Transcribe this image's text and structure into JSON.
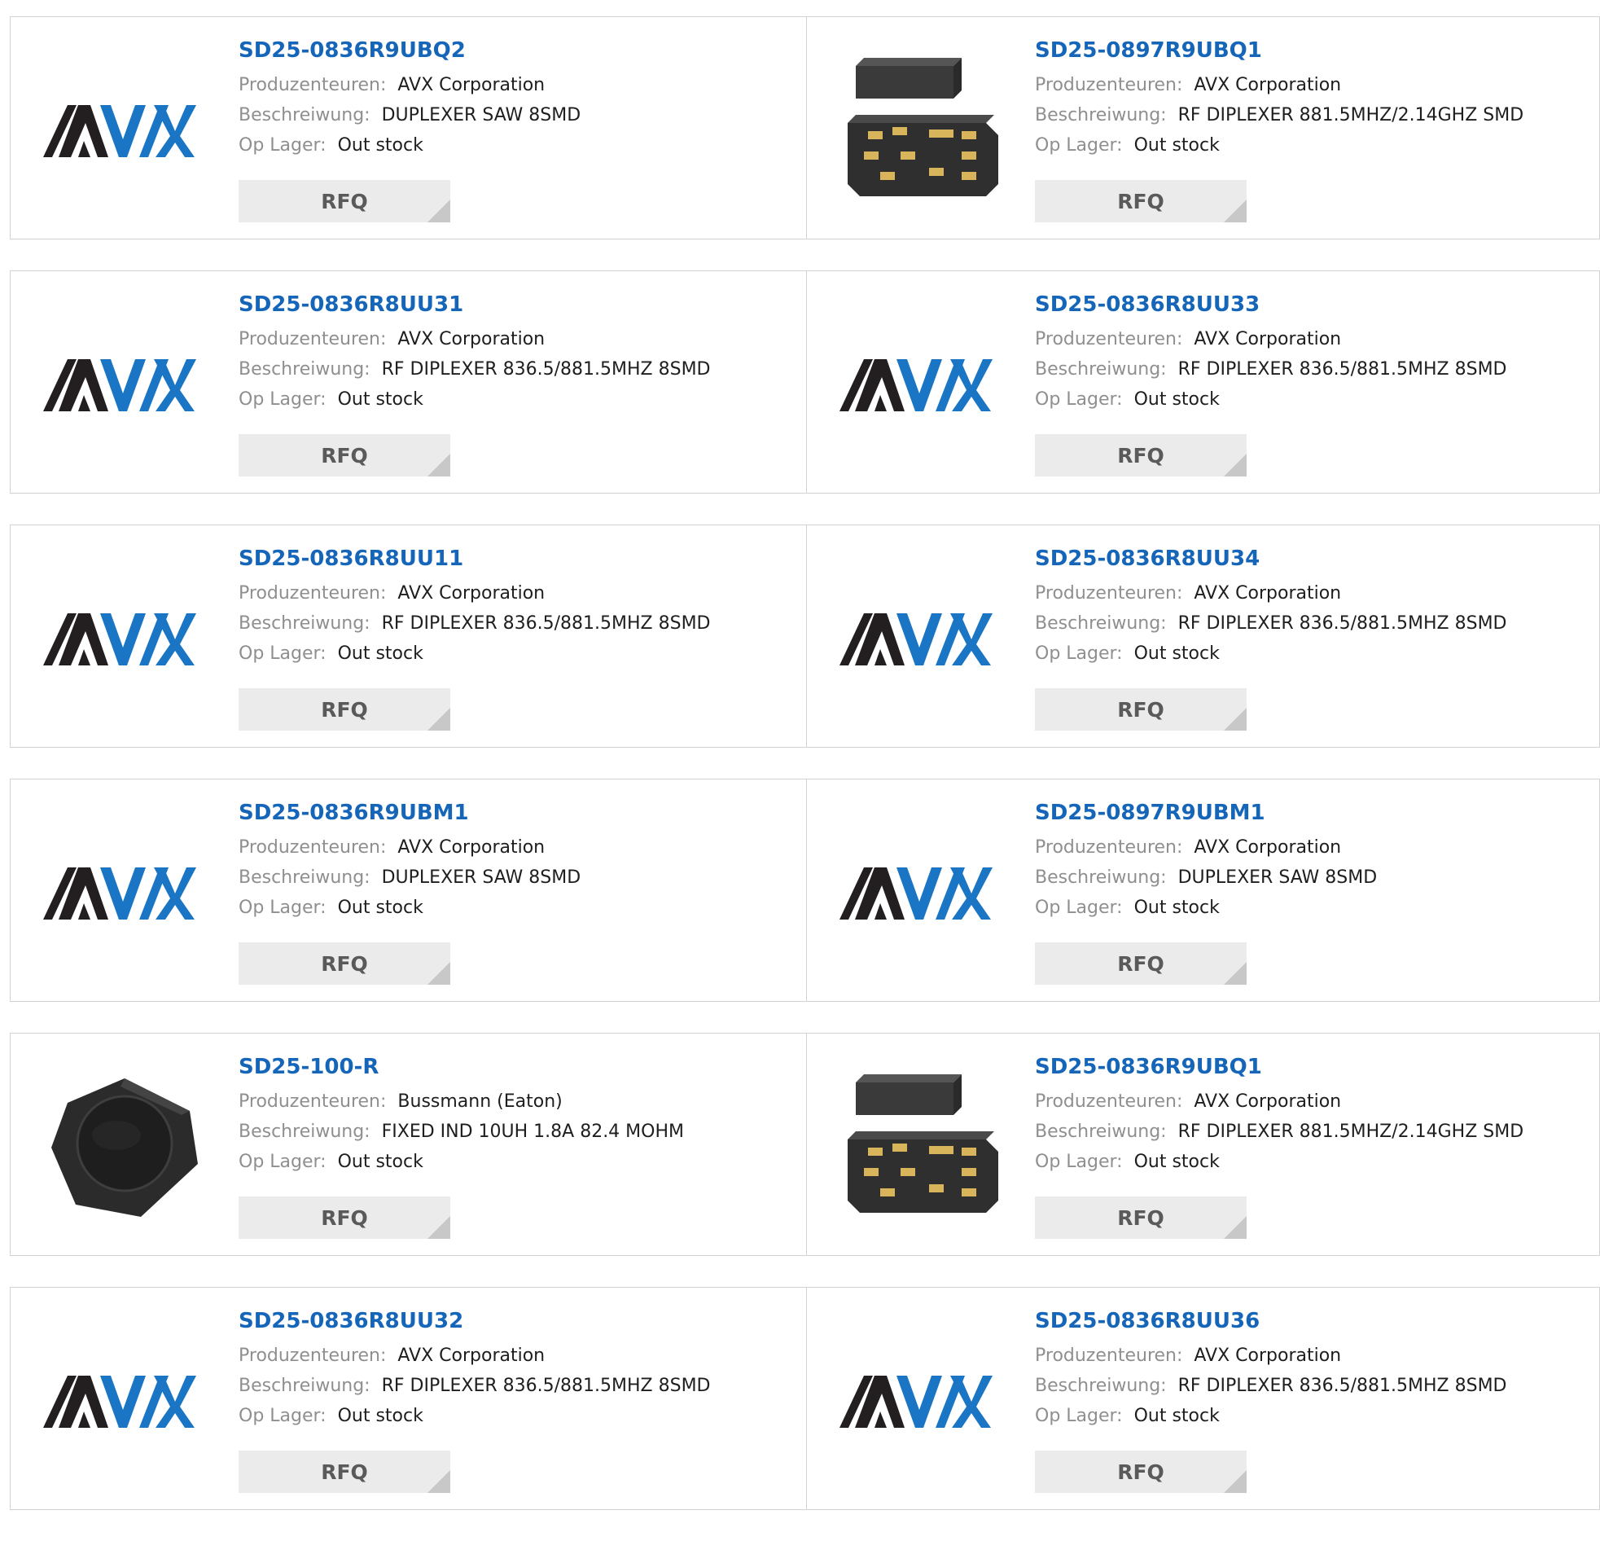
{
  "labels": {
    "manufacturer": "Produzenteuren:",
    "description": "Beschreiwung:",
    "stock": "Op Lager:"
  },
  "products": [
    {
      "part": "SD25-0836R9UBQ2",
      "manufacturer": "AVX Corporation",
      "description": "DUPLEXER SAW 8SMD",
      "stock": "Out stock",
      "rfq": "RFQ",
      "image": "avx-logo"
    },
    {
      "part": "SD25-0897R9UBQ1",
      "manufacturer": "AVX Corporation",
      "description": "RF DIPLEXER 881.5MHZ/2.14GHZ SMD",
      "stock": "Out stock",
      "rfq": "RFQ",
      "image": "chip-package"
    },
    {
      "part": "SD25-0836R8UU31",
      "manufacturer": "AVX Corporation",
      "description": "RF DIPLEXER 836.5/881.5MHZ 8SMD",
      "stock": "Out stock",
      "rfq": "RFQ",
      "image": "avx-logo"
    },
    {
      "part": "SD25-0836R8UU33",
      "manufacturer": "AVX Corporation",
      "description": "RF DIPLEXER 836.5/881.5MHZ 8SMD",
      "stock": "Out stock",
      "rfq": "RFQ",
      "image": "avx-logo"
    },
    {
      "part": "SD25-0836R8UU11",
      "manufacturer": "AVX Corporation",
      "description": "RF DIPLEXER 836.5/881.5MHZ 8SMD",
      "stock": "Out stock",
      "rfq": "RFQ",
      "image": "avx-logo"
    },
    {
      "part": "SD25-0836R8UU34",
      "manufacturer": "AVX Corporation",
      "description": "RF DIPLEXER 836.5/881.5MHZ 8SMD",
      "stock": "Out stock",
      "rfq": "RFQ",
      "image": "avx-logo"
    },
    {
      "part": "SD25-0836R9UBM1",
      "manufacturer": "AVX Corporation",
      "description": "DUPLEXER SAW 8SMD",
      "stock": "Out stock",
      "rfq": "RFQ",
      "image": "avx-logo"
    },
    {
      "part": "SD25-0897R9UBM1",
      "manufacturer": "AVX Corporation",
      "description": "DUPLEXER SAW 8SMD",
      "stock": "Out stock",
      "rfq": "RFQ",
      "image": "avx-logo"
    },
    {
      "part": "SD25-100-R",
      "manufacturer": "Bussmann (Eaton)",
      "description": "FIXED IND 10UH 1.8A 82.4 MOHM",
      "stock": "Out stock",
      "rfq": "RFQ",
      "image": "inductor"
    },
    {
      "part": "SD25-0836R9UBQ1",
      "manufacturer": "AVX Corporation",
      "description": "RF DIPLEXER 881.5MHZ/2.14GHZ SMD",
      "stock": "Out stock",
      "rfq": "RFQ",
      "image": "chip-package"
    },
    {
      "part": "SD25-0836R8UU32",
      "manufacturer": "AVX Corporation",
      "description": "RF DIPLEXER 836.5/881.5MHZ 8SMD",
      "stock": "Out stock",
      "rfq": "RFQ",
      "image": "avx-logo"
    },
    {
      "part": "SD25-0836R8UU36",
      "manufacturer": "AVX Corporation",
      "description": "RF DIPLEXER 836.5/881.5MHZ 8SMD",
      "stock": "Out stock",
      "rfq": "RFQ",
      "image": "avx-logo"
    }
  ],
  "colors": {
    "part_link": "#1565b8",
    "logo_dark": "#231f20",
    "logo_blue": "#1a76c4",
    "rfq_bg": "#ebebeb"
  }
}
